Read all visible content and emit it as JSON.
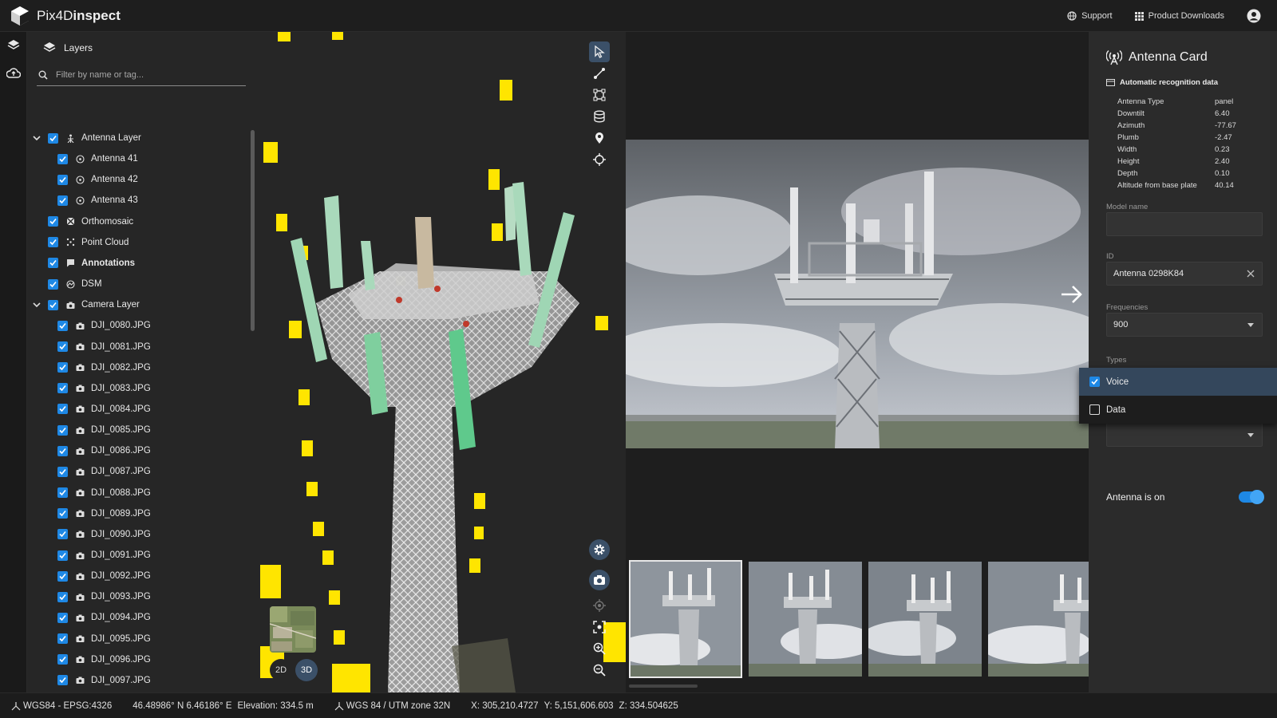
{
  "app": {
    "logo_prefix": "Pix4D",
    "logo_suffix": "inspect"
  },
  "topbar": {
    "support": "Support",
    "downloads": "Product Downloads"
  },
  "layers": {
    "title": "Layers",
    "filter_placeholder": "Filter by name or tag...",
    "rows": [
      {
        "label": "Antenna Layer",
        "level": 0,
        "expand": true,
        "icon": "antenna-layer-icon"
      },
      {
        "label": "Antenna 41",
        "level": 1,
        "icon": "antenna-icon"
      },
      {
        "label": "Antenna 42",
        "level": 1,
        "icon": "antenna-icon"
      },
      {
        "label": "Antenna 43",
        "level": 1,
        "icon": "antenna-icon"
      },
      {
        "label": "Orthomosaic",
        "level": 0,
        "icon": "orthomosaic-icon"
      },
      {
        "label": "Point Cloud",
        "level": 0,
        "icon": "point-cloud-icon"
      },
      {
        "label": "Annotations",
        "level": 0,
        "icon": "annotation-icon",
        "bold": true
      },
      {
        "label": "DSM",
        "level": 0,
        "icon": "dsm-icon"
      },
      {
        "label": "Camera Layer",
        "level": 0,
        "expand": true,
        "icon": "camera-icon"
      },
      {
        "label": "DJI_0080.JPG",
        "level": 1,
        "icon": "camera-icon"
      },
      {
        "label": "DJI_0081.JPG",
        "level": 1,
        "icon": "camera-icon"
      },
      {
        "label": "DJI_0082.JPG",
        "level": 1,
        "icon": "camera-icon"
      },
      {
        "label": "DJI_0083.JPG",
        "level": 1,
        "icon": "camera-icon"
      },
      {
        "label": "DJI_0084.JPG",
        "level": 1,
        "icon": "camera-icon"
      },
      {
        "label": "DJI_0085.JPG",
        "level": 1,
        "icon": "camera-icon"
      },
      {
        "label": "DJI_0086.JPG",
        "level": 1,
        "icon": "camera-icon"
      },
      {
        "label": "DJI_0087.JPG",
        "level": 1,
        "icon": "camera-icon"
      },
      {
        "label": "DJI_0088.JPG",
        "level": 1,
        "icon": "camera-icon"
      },
      {
        "label": "DJI_0089.JPG",
        "level": 1,
        "icon": "camera-icon"
      },
      {
        "label": "DJI_0090.JPG",
        "level": 1,
        "icon": "camera-icon"
      },
      {
        "label": "DJI_0091.JPG",
        "level": 1,
        "icon": "camera-icon"
      },
      {
        "label": "DJI_0092.JPG",
        "level": 1,
        "icon": "camera-icon"
      },
      {
        "label": "DJI_0093.JPG",
        "level": 1,
        "icon": "camera-icon"
      },
      {
        "label": "DJI_0094.JPG",
        "level": 1,
        "icon": "camera-icon"
      },
      {
        "label": "DJI_0095.JPG",
        "level": 1,
        "icon": "camera-icon"
      },
      {
        "label": "DJI_0096.JPG",
        "level": 1,
        "icon": "camera-icon"
      },
      {
        "label": "DJI_0097.JPG",
        "level": 1,
        "icon": "camera-icon"
      }
    ]
  },
  "view3d": {
    "btn_2d": "2D",
    "btn_3d": "3D",
    "active_mode": "3D"
  },
  "card": {
    "title": "Antenna Card",
    "auto_heading": "Automatic recognition data",
    "props": [
      {
        "k": "Antenna Type",
        "v": "panel"
      },
      {
        "k": "Downtilt",
        "v": "6.40"
      },
      {
        "k": "Azimuth",
        "v": "-77.67"
      },
      {
        "k": "Plumb",
        "v": "-2.47"
      },
      {
        "k": "Width",
        "v": "0.23"
      },
      {
        "k": "Height",
        "v": "2.40"
      },
      {
        "k": "Depth",
        "v": "0.10"
      },
      {
        "k": "Altitude from base plate",
        "v": "40.14"
      }
    ],
    "model_name_label": "Model name",
    "model_name_value": "",
    "id_label": "ID",
    "id_value": "Antenna 0298K84",
    "freq_label": "Frequencies",
    "freq_value": "900",
    "types_label": "Types",
    "types_options": [
      {
        "label": "Voice",
        "checked": true
      },
      {
        "label": "Data",
        "checked": false
      }
    ],
    "toggle_label": "Antenna is on",
    "toggle_on": true
  },
  "statusbar": {
    "crs": "WGS84 - EPSG:4326",
    "latlon": "46.48986° N 6.46186° E",
    "elevation": "Elevation: 334.5 m",
    "utm": "WGS 84 / UTM zone 32N",
    "x": "X: 305,210.4727",
    "y": "Y: 5,151,606.603",
    "z": "Z: 334.504625"
  },
  "colors": {
    "accent": "#1e88e5",
    "panel": "#262626",
    "card": "#2b2b2b",
    "selection": "#34475c",
    "marker": "#ffe500"
  }
}
